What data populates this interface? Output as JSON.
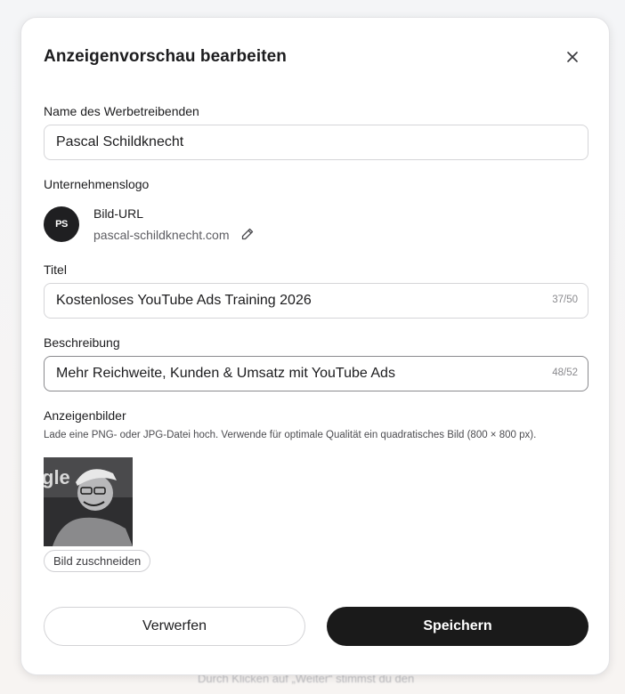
{
  "backdrop": {
    "consent_text": "Durch Klicken auf „Weiter“ stimmst du den"
  },
  "dialog": {
    "title": "Anzeigenvorschau bearbeiten",
    "close_icon": "close-icon"
  },
  "advertiser": {
    "label": "Name des Werbetreibenden",
    "value": "Pascal Schildknecht"
  },
  "logo": {
    "label": "Unternehmenslogo",
    "initials": "PS",
    "title": "Bild-URL",
    "url": "pascal-schildknecht.com",
    "edit_icon": "pencil-icon"
  },
  "title_field": {
    "label": "Titel",
    "value": "Kostenloses YouTube Ads Training 2026",
    "counter": "37/50"
  },
  "description_field": {
    "label": "Beschreibung",
    "value": "Mehr Reichweite, Kunden & Umsatz mit YouTube Ads",
    "counter": "48/52"
  },
  "images": {
    "label": "Anzeigenbilder",
    "helper": "Lade eine PNG- oder JPG-Datei hoch. Verwende für optimale Qualität ein quadratisches Bild (800 × 800 px).",
    "crop_button": "Bild zuschneiden"
  },
  "actions": {
    "discard": "Verwerfen",
    "save": "Speichern"
  },
  "colors": {
    "primary_button": "#1a1a1a",
    "border": "#d5d5d8"
  }
}
